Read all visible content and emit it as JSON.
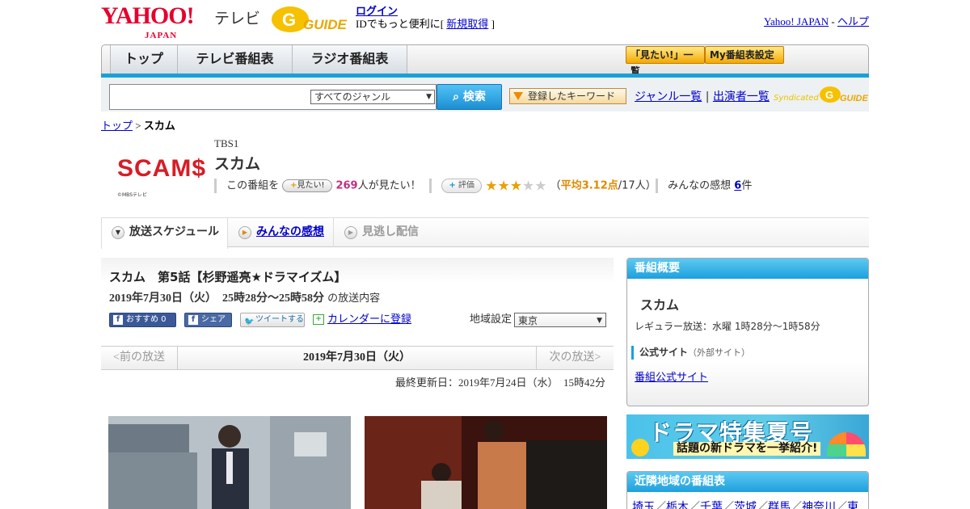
{
  "header": {
    "logo_text": "YAHOO!",
    "logo_sub": "JAPAN",
    "tv_label": "テレビ",
    "gguide_logo": "G GUIDE",
    "login_label": "ログイン",
    "id_prompt_prefix": "IDでもっと便利に[",
    "signup_label": "新規取得",
    "id_prompt_suffix": "]",
    "yahoo_japan_link": "Yahoo! JAPAN",
    "separator": "-",
    "help_link": "ヘルプ"
  },
  "nav": {
    "tabs": [
      "トップ",
      "テレビ番組表",
      "ラジオ番組表"
    ],
    "buttons": [
      "「見たい!」一覧",
      "My番組表設定"
    ]
  },
  "search": {
    "input_value": "",
    "genre_selected": "すべてのジャンル",
    "search_button": "検索",
    "keyword_button": "登録したキーワード",
    "genre_list_link": "ジャンル一覧",
    "pipe": "|",
    "cast_list_link": "出演者一覧",
    "syndicated_label": "Syndicated",
    "syndicated_logo": "G GUIDE"
  },
  "breadcrumb": {
    "top_link": "トップ",
    "sep": ">",
    "current": "スカム"
  },
  "program": {
    "logo_text": "SCAM$",
    "logo_caption": "©MBSテレビ",
    "channel": "TBS1",
    "title": "スカム",
    "want_prefix": "この番組を",
    "want_button": "見たい!",
    "want_count": "269",
    "want_suffix": "人が見たい！",
    "rating_button": "評価",
    "rating_stars": 3,
    "rating_max": 5,
    "rating_open": "（",
    "rating_avg_text": "平均3.12点",
    "rating_count_text": "/17人）",
    "impressions_prefix": "みんなの感想",
    "impressions_count": "6",
    "impressions_suffix": "件"
  },
  "subtabs": [
    "放送スケジュール",
    "みんなの感想",
    "見逃し配信"
  ],
  "episode": {
    "title": "スカム　第5話【杉野遥亮★ドラマイズム】",
    "datetime": "2019年7月30日（火）　25時28分～25時58分",
    "datetime_suffix": "の放送内容",
    "share": {
      "facebook_recommend": "おすすめ 0",
      "facebook_share": "シェア",
      "tweet": "ツイートする",
      "calendar": "カレンダーに登録"
    },
    "region_label": "地域設定",
    "region_selected": "東京"
  },
  "date_nav": {
    "prev": "<前の放送",
    "current": "2019年7月30日（火）",
    "next": "次の放送>"
  },
  "updated": {
    "label": "最終更新日：",
    "date": "2019年7月24日（水）　15時42分"
  },
  "sidebar": {
    "summary_header": "番組概要",
    "program_name": "スカム",
    "regular_broadcast": "レギュラー放送：水曜 1時28分～1時58分",
    "official_site_label": "公式サイト",
    "official_site_note": "（外部サイト）",
    "official_site_link": "番組公式サイト",
    "banner_title": "ドラマ特集夏号",
    "banner_sub": "話題の新ドラマを一挙紹介!",
    "nearby_header": "近隣地域の番組表",
    "nearby_regions": [
      "埼玉",
      "栃木",
      "千葉",
      "茨城",
      "群馬",
      "神奈川",
      "東"
    ]
  },
  "colors": {
    "accent_blue": "#1aa0d8",
    "yahoo_red": "#e6002d",
    "link": "#0000cc",
    "star": "#e8a000",
    "want_count": "#c03080"
  }
}
